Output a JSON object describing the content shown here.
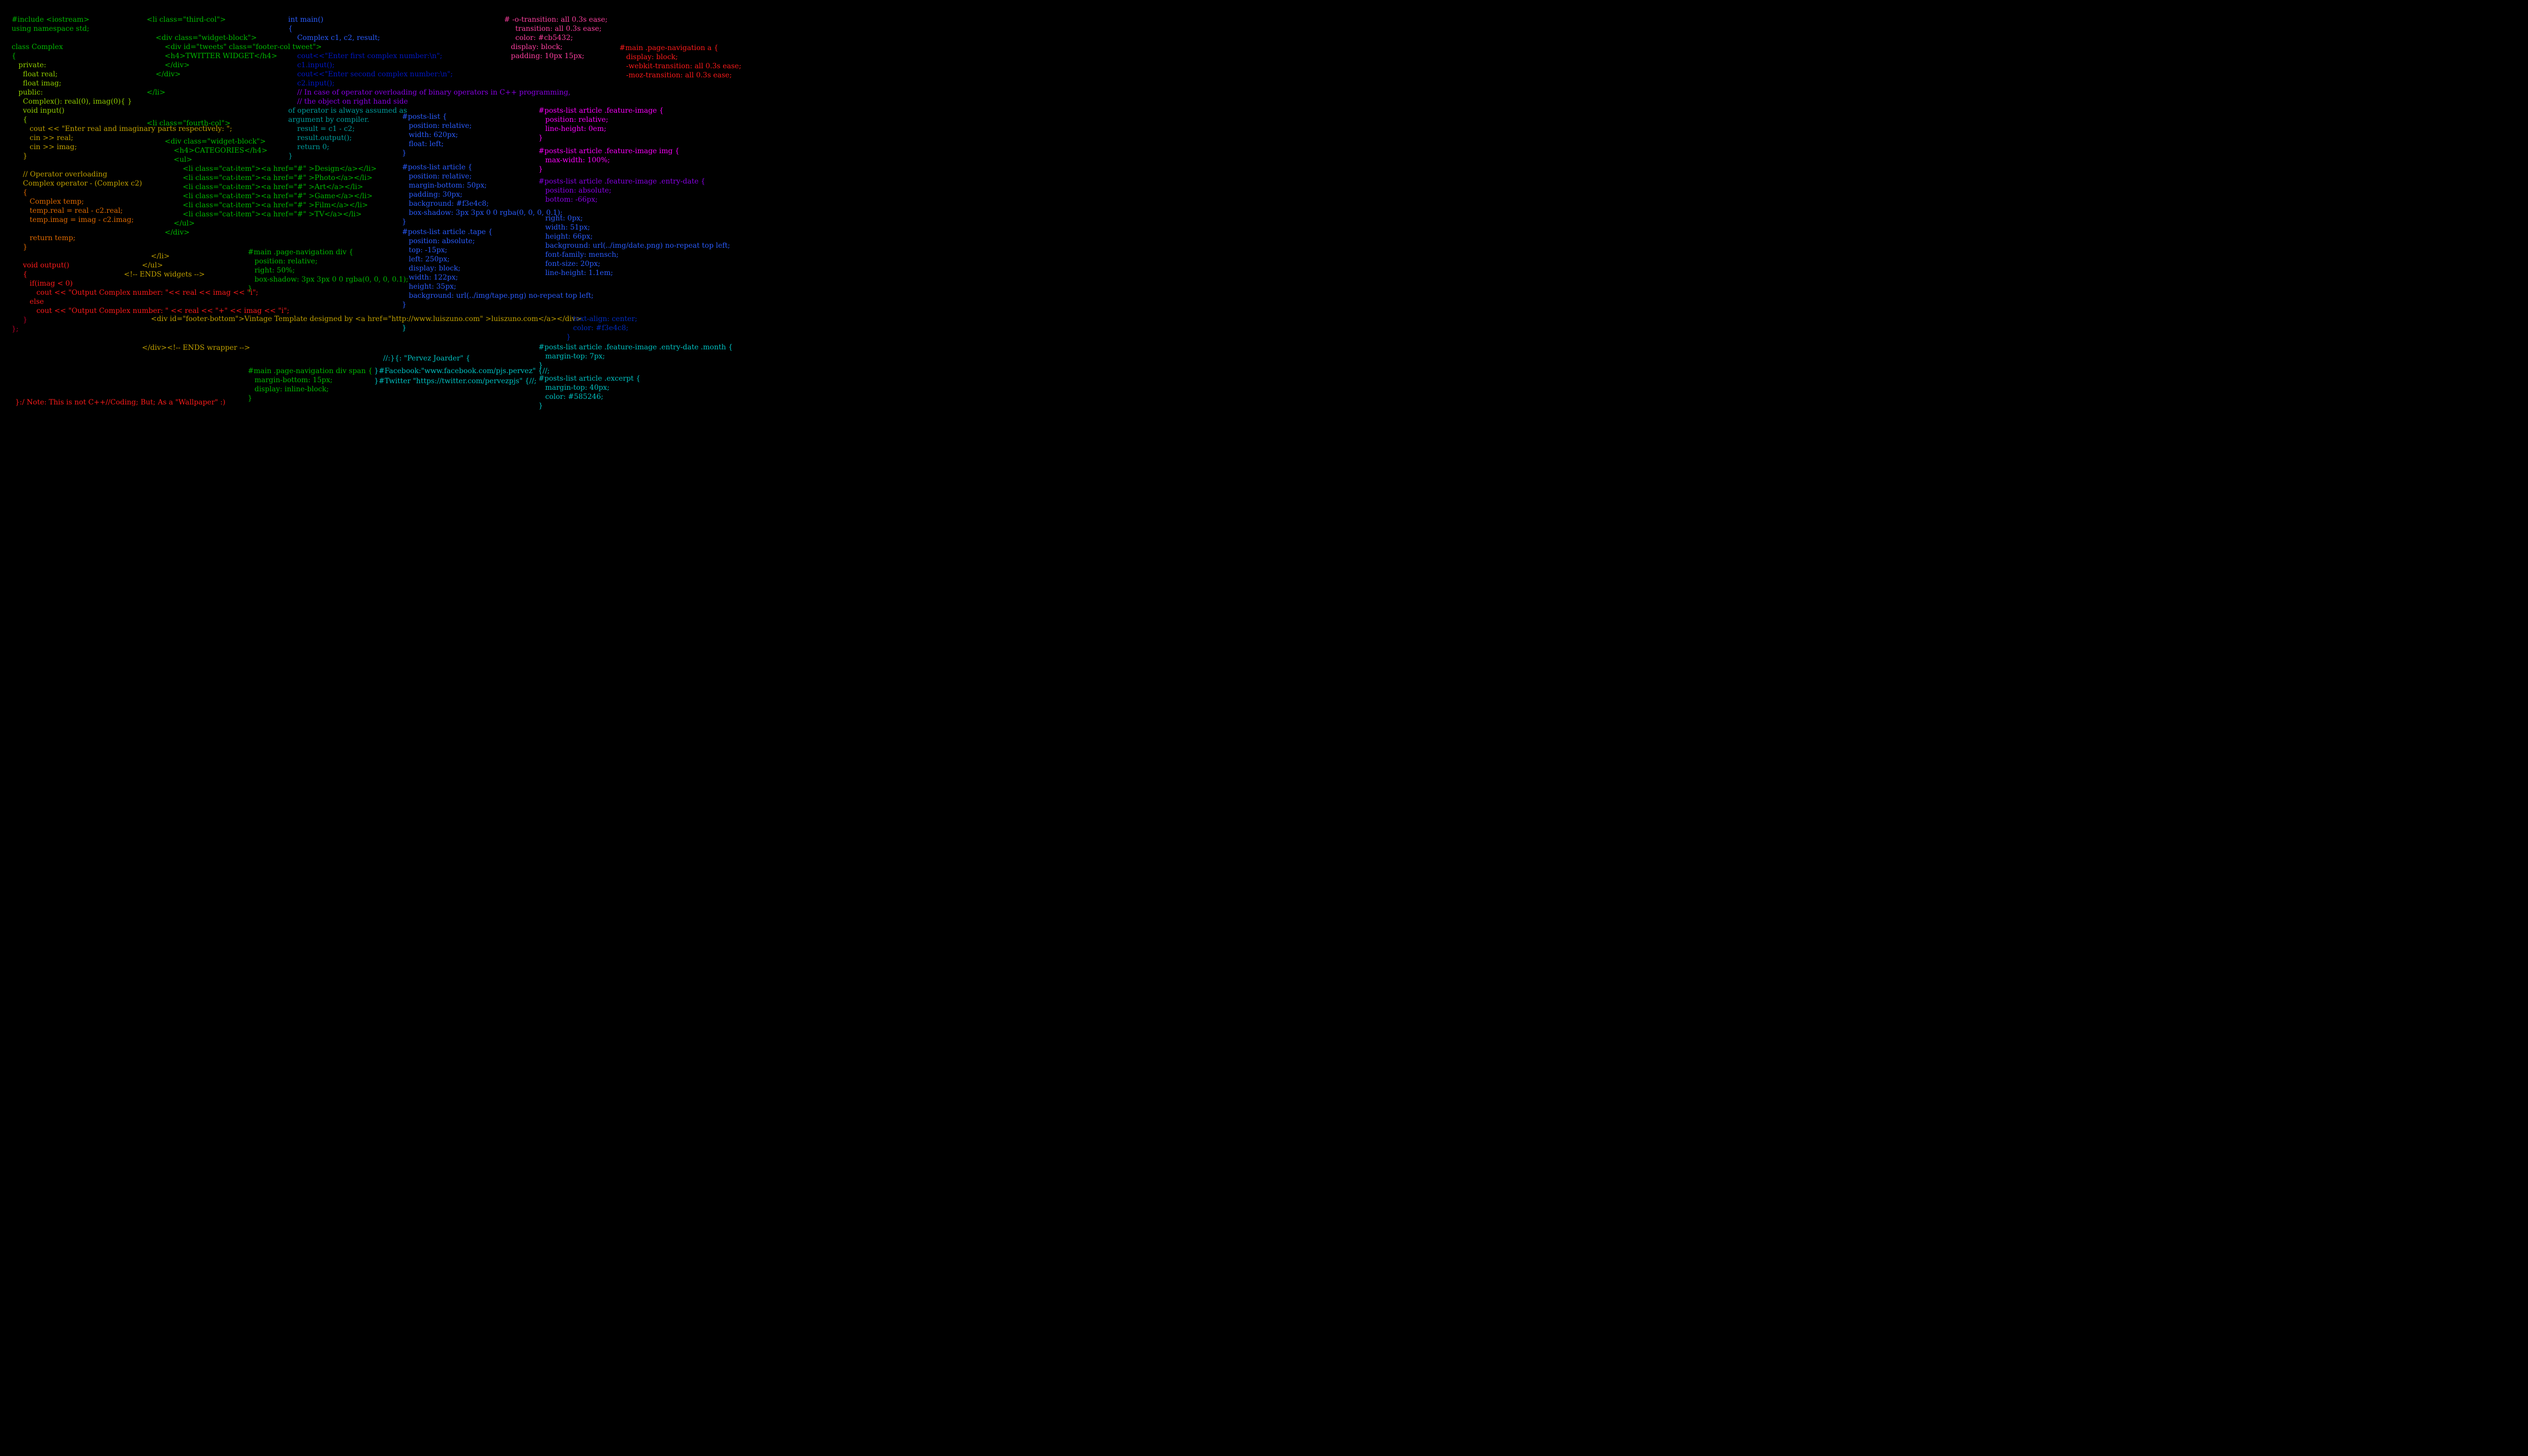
{
  "cpp": {
    "l01": "#include <iostream>",
    "l02": "using namespace std;",
    "l03": "",
    "l04": "class Complex",
    "l05": "{",
    "l06": "   private:",
    "l07": "     float real;",
    "l08": "     float imag;",
    "l09": "   public:",
    "l10": "     Complex(): real(0), imag(0){ }",
    "l11": "     void input()",
    "l12": "     {",
    "l13": "        cout << \"Enter real and imaginary parts respectively: \";",
    "l14": "        cin >> real;",
    "l15": "        cin >> imag;",
    "l16": "     }",
    "l17": "",
    "l18": "     // Operator overloading",
    "l19": "     Complex operator - (Complex c2)",
    "l20": "     {",
    "l21": "        Complex temp;",
    "l22": "        temp.real = real - c2.real;",
    "l23": "        temp.imag = imag - c2.imag;",
    "l24": "",
    "l25": "        return temp;",
    "l26": "     }",
    "l27": "",
    "l28": "     void output()",
    "l29": "     {",
    "l30": "        if(imag < 0)",
    "l31": "           cout << \"Output Complex number: \"<< real << imag << \"i\";",
    "l32": "        else",
    "l33": "           cout << \"Output Complex number: \" << real << \"+\" << imag << \"i\";",
    "l34": "     }",
    "l35": "};",
    "main01": "int main()",
    "main02": "{",
    "main03": "    Complex c1, c2, result;",
    "main04": "",
    "main05": "    cout<<\"Enter first complex number:\\n\";",
    "main06": "    c1.input();",
    "main07": "    cout<<\"Enter second complex number:\\n\";",
    "main08": "    c2.input();",
    "main09": "    // In case of operator overloading of binary operators in C++ programming,",
    "main10": "    // the object on right hand side",
    "main11": "of operator is always assumed as",
    "main12": "argument by compiler.",
    "main13": "    result = c1 - c2;",
    "main14": "    result.output();",
    "main15": "    return 0;",
    "main16": "}",
    "note": "}:/ Note: This is not C++//Coding; But; As a \"Wallpaper\" :)"
  },
  "html": {
    "thirdcol_open": "<li class=\"third-col\">",
    "wb_open": "    <div class=\"widget-block\">",
    "tweets_open": "        <div id=\"tweets\" class=\"footer-col tweet\">",
    "h4_twitter": "        <h4>TWITTER WIDGET</h4>",
    "div_close1": "        </div>",
    "div_close2": "    </div>",
    "li_close1": "</li>",
    "fourthcol_open": "<li class=\"fourth-col\">",
    "wb2_open": "        <div class=\"widget-block\">",
    "h4_categories": "            <h4>CATEGORIES</h4>",
    "ul_open": "            <ul>",
    "cat1": "                <li class=\"cat-item\"><a href=\"#\" >Design</a></li>",
    "cat2": "                <li class=\"cat-item\"><a href=\"#\" >Photo</a></li>",
    "cat3": "                <li class=\"cat-item\"><a href=\"#\" >Art</a></li>",
    "cat4": "                <li class=\"cat-item\"><a href=\"#\" >Game</a></li>",
    "cat5": "                <li class=\"cat-item\"><a href=\"#\" >Film</a></li>",
    "cat6": "                <li class=\"cat-item\"><a href=\"#\" >TV</a></li>",
    "ul_close": "            </ul>",
    "div_close3": "        </div>",
    "li_close2": "            </li>",
    "ul_close2": "        </ul>",
    "ends_widgets": "<!-- ENDS widgets -->",
    "footer_bottom": "            <div id=\"footer-bottom\">Vintage Template designed by <a href=\"http://www.luiszuno.com\" >luiszuno.com</a></div>",
    "ends_wrapper": "        </div><!-- ENDS wrapper -->"
  },
  "css": {
    "nav_div": "#main .page-navigation div {\n   position: relative;\n   right: 50%;\n   box-shadow: 3px 3px 0 0 rgba(0, 0, 0, 0.1);\n}",
    "nav_span": "#main .page-navigation div span {\n   margin-bottom: 15px;\n   display: inline-block;\n}",
    "posts_list": "#posts-list {\n   position: relative;\n   width: 620px;\n   float: left;\n}",
    "posts_article": "#posts-list article {\n   position: relative;\n   margin-bottom: 50px;\n   padding: 30px;\n   background: #f3e4c8;\n   box-shadow: 3px 3px 0 0 rgba(0, 0, 0, 0.1);\n}",
    "tape": "#posts-list article .tape {\n   position: absolute;\n   top: -15px;\n   left: 250px;\n   display: block;\n   width: 122px;\n   height: 35px;\n   background: url(../img/tape.png) no-repeat top left;\n}",
    "top_right": "# -o-transition: all 0.3s ease;\n     transition: all 0.3s ease;\n     color: #cb5432;\n   display: block;\n   padding: 10px 15px;",
    "main_nav_a": "#main .page-navigation a {\n   display: block;\n   -webkit-transition: all 0.3s ease;\n   -moz-transition: all 0.3s ease;",
    "feature_image": "#posts-list article .feature-image {\n   position: relative;\n   line-height: 0em;\n}",
    "feature_image_img": "#posts-list article .feature-image img {\n   max-width: 100%;\n}",
    "entry_date": "#posts-list article .feature-image .entry-date {\n   position: absolute;\n   bottom: -66px;",
    "entry_date2": "   right: 0px;\n   width: 51px;\n   height: 66px;\n   background: url(../img/date.png) no-repeat top left;\n   font-family: mensch;\n   font-size: 20px;\n   line-height: 1.1em;",
    "entry_date3": "   text-align: center;\n   color: #f3e4c8;\n}",
    "month": "#posts-list article .feature-image .entry-date .month {\n   margin-top: 7px;\n}",
    "excerpt": "#posts-list article .excerpt {\n   margin-top: 40px;\n   color: #585246;\n}"
  },
  "social": {
    "header": "    //:}{: \"Pervez Joarder\" {",
    "fb": "}#Facebook:\"www.facebook.com/pjs.pervez\" {//;",
    "tw": "}#Twitter \"https://twitter.com/pervezpjs\" {//;"
  }
}
